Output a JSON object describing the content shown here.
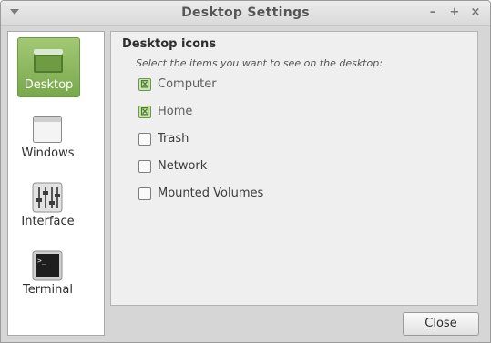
{
  "window": {
    "title": "Desktop Settings"
  },
  "sidebar": {
    "items": [
      {
        "label": "Desktop",
        "icon": "desktop-icon",
        "active": true
      },
      {
        "label": "Windows",
        "icon": "windows-icon",
        "active": false
      },
      {
        "label": "Interface",
        "icon": "sliders-icon",
        "active": false
      },
      {
        "label": "Terminal",
        "icon": "terminal-icon",
        "active": false
      }
    ]
  },
  "content": {
    "title": "Desktop icons",
    "hint": "Select the items you want to see on the desktop:",
    "options": [
      {
        "label": "Computer",
        "checked": true
      },
      {
        "label": "Home",
        "checked": true
      },
      {
        "label": "Trash",
        "checked": false
      },
      {
        "label": "Network",
        "checked": false
      },
      {
        "label": "Mounted Volumes",
        "checked": false
      }
    ]
  },
  "footer": {
    "close_label_first": "C",
    "close_label_rest": "lose"
  },
  "colors": {
    "accent": "#79a84c",
    "window_bg": "#d6d6d6",
    "panel_bg": "#efefef"
  }
}
